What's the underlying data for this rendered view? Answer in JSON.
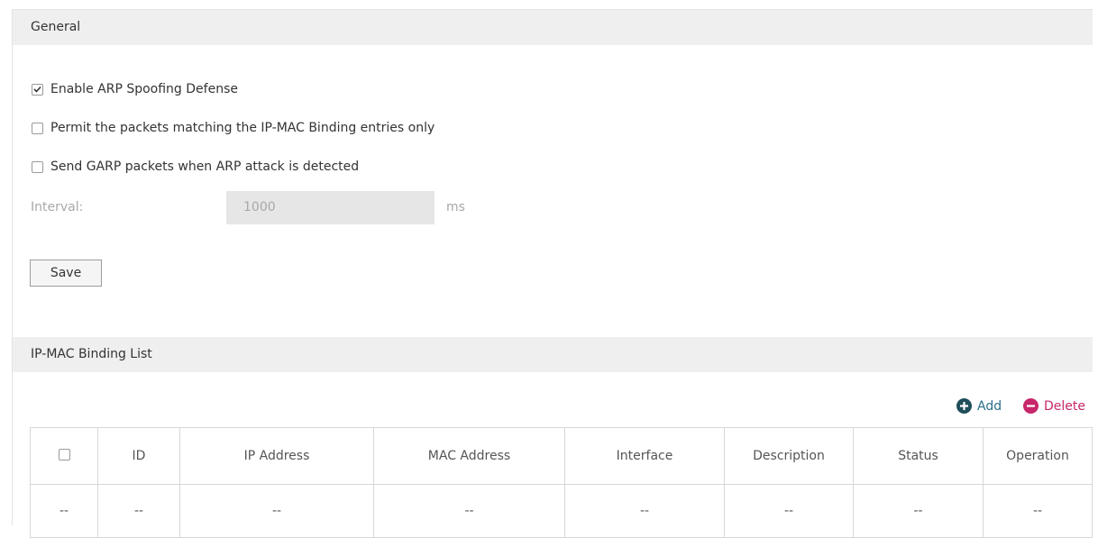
{
  "general": {
    "title": "General",
    "enable_arp_label": "Enable ARP Spoofing Defense",
    "enable_arp_checked": true,
    "permit_label": "Permit the packets matching the IP-MAC Binding entries only",
    "permit_checked": false,
    "garp_label": "Send GARP packets when ARP attack is detected",
    "garp_checked": false,
    "interval_label": "Interval:",
    "interval_value": "1000",
    "interval_unit": "ms",
    "save_label": "Save"
  },
  "binding_list": {
    "title": "IP-MAC Binding List",
    "add_label": "Add",
    "delete_label": "Delete",
    "columns": [
      "ID",
      "IP Address",
      "MAC Address",
      "Interface",
      "Description",
      "Status",
      "Operation"
    ],
    "rows": [
      [
        "--",
        "--",
        "--",
        "--",
        "--",
        "--",
        "--",
        "--"
      ]
    ]
  },
  "colors": {
    "add_icon": "#1f4e5a",
    "delete_icon": "#c7266a",
    "link_text": "#2a6f89",
    "delete_text": "#c7266a"
  }
}
